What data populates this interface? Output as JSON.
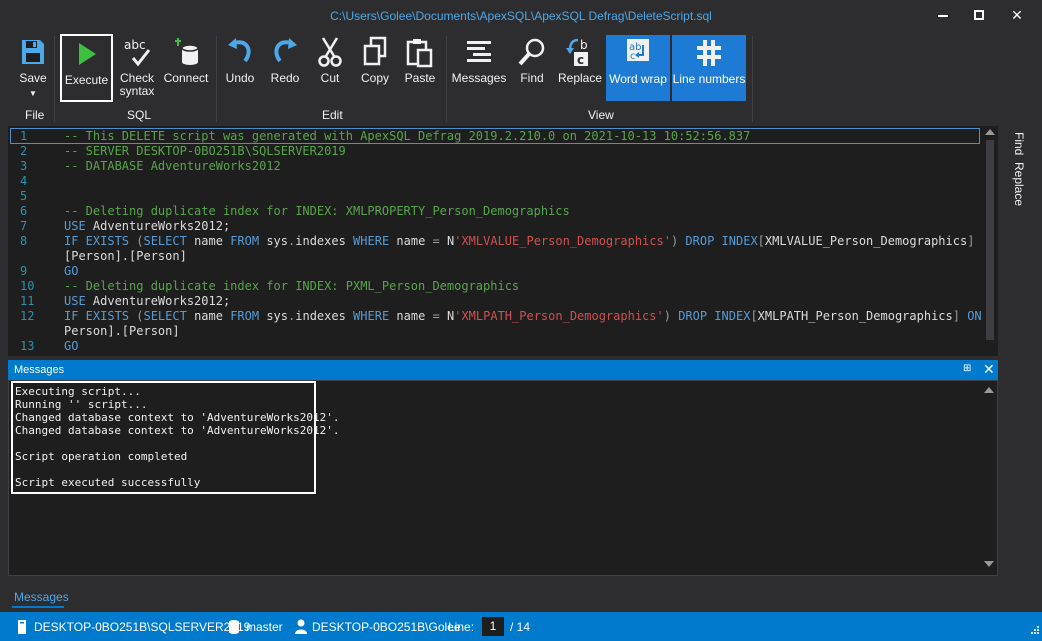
{
  "window": {
    "title": "C:\\Users\\Golee\\Documents\\ApexSQL\\ApexSQL Defrag\\DeleteScript.sql"
  },
  "ribbon": {
    "file": {
      "group_label": "File",
      "save_label": "Save"
    },
    "sql": {
      "group_label": "SQL",
      "execute_label": "Execute",
      "check_label_1": "Check",
      "check_label_2": "syntax",
      "connect_label": "Connect"
    },
    "edit": {
      "group_label": "Edit",
      "undo_label": "Undo",
      "redo_label": "Redo",
      "cut_label": "Cut",
      "copy_label": "Copy",
      "paste_label": "Paste"
    },
    "view": {
      "group_label": "View",
      "messages_label": "Messages",
      "find_label": "Find",
      "replace_label": "Replace",
      "wordwrap_label": "Word wrap",
      "linenumbers_label": "Line numbers"
    }
  },
  "side_tabs": {
    "find": "Find",
    "replace": "Replace"
  },
  "editor": {
    "line_numbers": [
      "1",
      "2",
      "3",
      "4",
      "5",
      "6",
      "7",
      "8",
      "",
      "9",
      "10",
      "11",
      "12",
      "",
      "13"
    ],
    "lines": {
      "l1": "-- This DELETE script was generated with ApexSQL Defrag 2019.2.210.0 on 2021-10-13 10:52:56.837",
      "l2": "-- SERVER DESKTOP-0BO251B\\SQLSERVER2019",
      "l3": "-- DATABASE AdventureWorks2012",
      "l6": "-- Deleting duplicate index for INDEX: XMLPROPERTY_Person_Demographics",
      "l7_kw": "USE",
      "l7_rest": " AdventureWorks2012;",
      "l8_if": "IF EXISTS",
      "l8_p1": " (",
      "l8_select": "SELECT",
      "l8_name1": " name ",
      "l8_from": "FROM",
      "l8_sys": " sys",
      "l8_dot": ".",
      "l8_indexes": "indexes ",
      "l8_where": "WHERE",
      "l8_name2": " name ",
      "l8_eq": "=",
      "l8_n": " N",
      "l8_str": "'XMLVALUE_Person_Demographics'",
      "l8_p2": ") ",
      "l8_drop": "DROP INDEX",
      "l8_br": "[",
      "l8_idx": "XMLVALUE_Person_Demographics",
      "l8_br2": "] ",
      "l8_on": "ON",
      "l8b": "[Person].[Person]",
      "l9": "GO",
      "l10": "-- Deleting duplicate index for INDEX: PXML_Person_Demographics",
      "l11_kw": "USE",
      "l11_rest": " AdventureWorks2012;",
      "l12_str": "'XMLPATH_Person_Demographics'",
      "l12_idx": "XMLPATH_Person_Demographics",
      "l12_on": "ON[",
      "l12b": "Person].[Person]",
      "l13": "GO"
    }
  },
  "messages": {
    "title": "Messages",
    "lines": [
      "Executing script...",
      "Running '' script...",
      "Changed database context to 'AdventureWorks2012'.",
      "Changed database context to 'AdventureWorks2012'.",
      "",
      "Script operation completed",
      "",
      "Script executed successfully"
    ]
  },
  "bottom_tab": "Messages",
  "status": {
    "server": "DESKTOP-0BO251B\\SQLSERVER2019",
    "database": "master",
    "user": "DESKTOP-0BO251B\\Golee",
    "line_label": "Line:",
    "line_value": "1",
    "line_total": "/ 14"
  },
  "colors": {
    "accent": "#007acc",
    "comment": "#57a64a",
    "keyword": "#569cd6",
    "string": "#d05050"
  }
}
